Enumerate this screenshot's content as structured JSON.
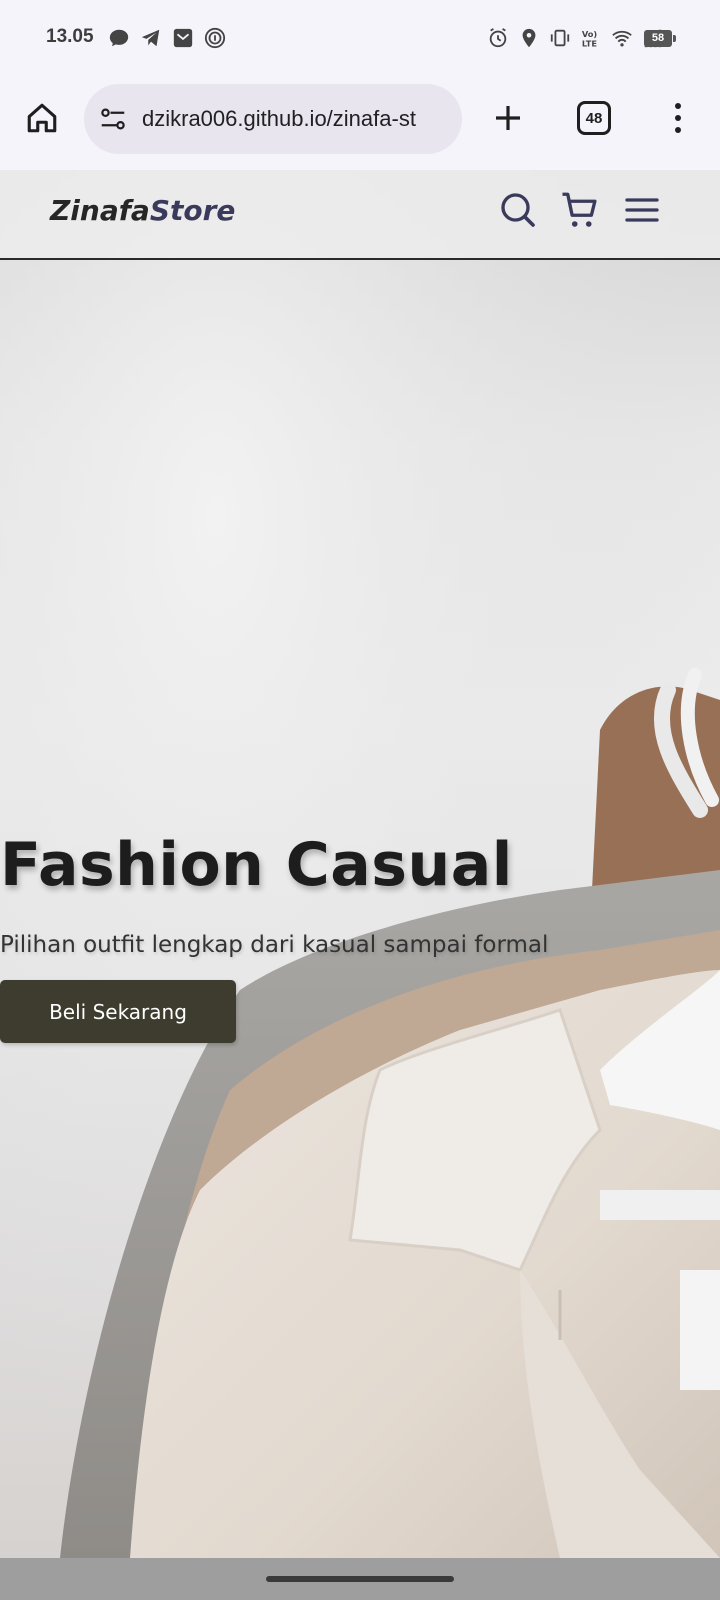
{
  "status_bar": {
    "time": "13.05",
    "left_icons": [
      "chat-bubble-icon",
      "telegram-icon",
      "inbox-icon",
      "fingerprint-icon"
    ],
    "right_icons": [
      "alarm-icon",
      "location-icon",
      "vibrate-icon",
      "volte-icon",
      "wifi-icon",
      "signal-icon"
    ],
    "volte_label": "Vo) LTE",
    "battery_level": "58"
  },
  "browser": {
    "url": "dzikra006.github.io/zinafa-st",
    "tab_count": "48"
  },
  "site": {
    "logo_part1": "Zinafa",
    "logo_part2": "Store",
    "header_icons": [
      "search-icon",
      "cart-icon",
      "hamburger-menu-icon"
    ]
  },
  "hero": {
    "title": "Fashion Casual",
    "subtitle": "Pilihan outfit lengkap dari kasual sampai formal",
    "cta_label": "Beli Sekarang"
  },
  "colors": {
    "button_bg": "#3e3b2f",
    "logo_accent": "#3a3a5c",
    "browser_bg": "#f6f4fb"
  }
}
